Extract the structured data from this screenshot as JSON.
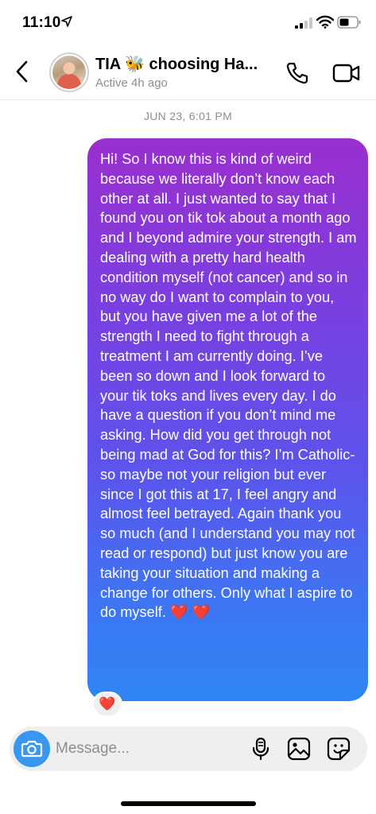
{
  "status_bar": {
    "time": "11:10"
  },
  "header": {
    "contact_name": "TIA 🐝 choosing Ha...",
    "contact_status": "Active 4h ago"
  },
  "thread": {
    "timestamp": "JUN 23, 6:01 PM",
    "message": "Hi! So I know this is kind of weird because we literally don’t know each other at all. I just wanted to say that I found you on tik tok about a month ago and I beyond admire your strength. I am dealing with a pretty hard health condition myself (not cancer) and so in no way do I want to complain to you, but you have given me a lot of the strength I need to fight through a treatment I am currently doing. I’ve been so down and I look forward to your tik toks and lives every day. I do have a question if you don’t mind me asking. How did you get through not being mad at God for this? I’m Catholic-so maybe not your religion but ever since I got this at 17, I feel angry and almost feel betrayed. Again thank you so much (and I understand you may not read or respond) but just know you are taking your situation and making a change for others. Only what I aspire to do myself. ❤️ ❤️",
    "reaction": "❤️"
  },
  "composer": {
    "placeholder": "Message...",
    "value": ""
  },
  "colors": {
    "bubble_top": "#9a2fcf",
    "bubble_bottom": "#2f86f3",
    "camera_button": "#3897f0"
  },
  "icons": [
    "location-arrow-icon",
    "signal-icon",
    "wifi-icon",
    "battery-icon",
    "back-chevron-icon",
    "phone-icon",
    "video-camera-icon",
    "camera-icon",
    "microphone-icon",
    "image-icon",
    "sticker-icon"
  ]
}
